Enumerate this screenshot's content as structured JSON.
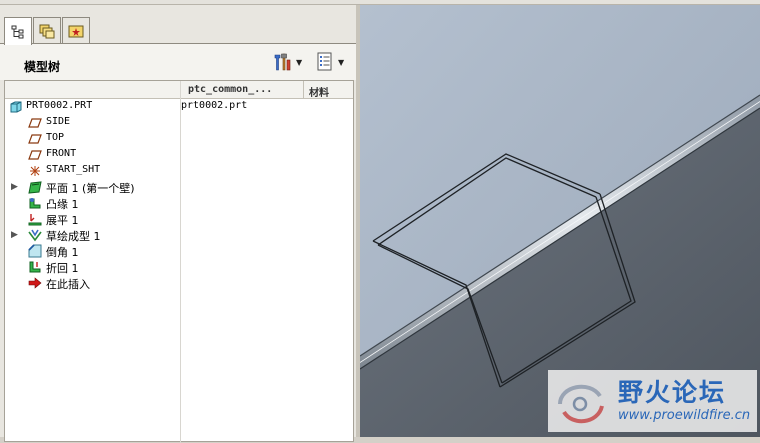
{
  "navigator": {
    "tabs": [
      {
        "name": "model-tree-tab",
        "icon": "model-tree-icon"
      },
      {
        "name": "folder-browser-tab",
        "icon": "folder-browser-icon"
      },
      {
        "name": "favorites-tab",
        "icon": "favorites-icon"
      }
    ],
    "panel_title": "模型树",
    "settings_icon": "tools-icon",
    "show_icon": "list-icon"
  },
  "tree": {
    "columns": [
      "ptc_common_...",
      "材料"
    ],
    "root": {
      "label": "PRT0002.PRT",
      "value": "prt0002.prt",
      "icon": "part-icon"
    },
    "items": [
      {
        "label": "SIDE",
        "icon": "datum-plane-icon",
        "expandable": false
      },
      {
        "label": "TOP",
        "icon": "datum-plane-icon",
        "expandable": false
      },
      {
        "label": "FRONT",
        "icon": "datum-plane-icon",
        "expandable": false
      },
      {
        "label": "START_SHT",
        "icon": "coordinate-system-icon",
        "expandable": false
      },
      {
        "label": "平面 1 (第一个壁)",
        "icon": "planar-wall-icon",
        "expandable": true
      },
      {
        "label": "凸缘 1",
        "icon": "flange-icon",
        "expandable": false
      },
      {
        "label": "展平 1",
        "icon": "unbend-icon",
        "expandable": false
      },
      {
        "label": "草绘成型 1",
        "icon": "sketched-form-icon",
        "expandable": true
      },
      {
        "label": "倒角 1",
        "icon": "chamfer-icon",
        "expandable": false
      },
      {
        "label": "折回 1",
        "icon": "bend-back-icon",
        "expandable": false
      },
      {
        "label": "在此插入",
        "icon": "insert-here-icon",
        "expandable": false
      }
    ]
  },
  "watermark": {
    "cn": "野火论坛",
    "url": "www.proewildfire.cn"
  },
  "colors": {
    "viewport_top": "#a4b1c2",
    "viewport_bottom": "#5e6670",
    "accent": "#2a67b8"
  }
}
